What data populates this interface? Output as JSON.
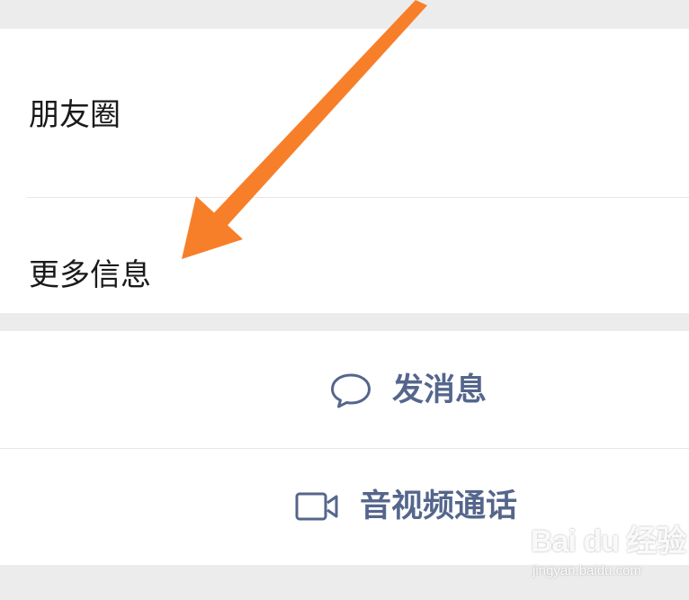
{
  "profile_rows": {
    "moments_label": "朋友圈",
    "more_info_label": "更多信息"
  },
  "actions": {
    "send_message_label": "发消息",
    "av_call_label": "音视频通话"
  },
  "colors": {
    "background": "#ececec",
    "card": "#ffffff",
    "action_text": "#55668c",
    "annotation_arrow": "#f77f2a"
  },
  "icons": {
    "send_message": "chat-bubble-icon",
    "av_call": "video-camera-icon"
  },
  "watermark": {
    "brand": "Bai du 经验",
    "url": "jingyan.baidu.com"
  }
}
